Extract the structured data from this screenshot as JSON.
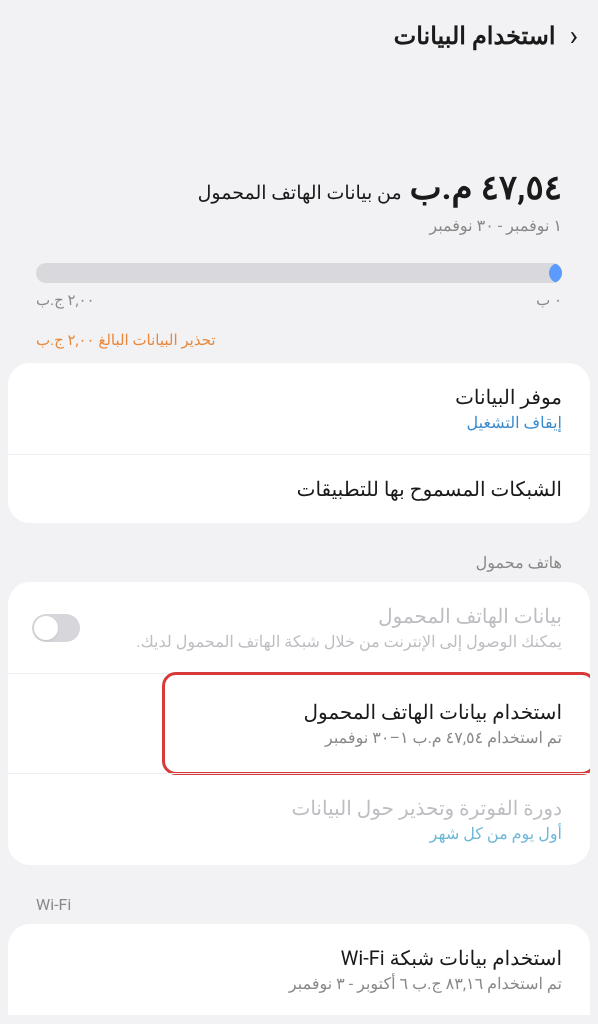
{
  "header": {
    "title": "استخدام البيانات"
  },
  "summary": {
    "amount": "٤٧,٥٤",
    "unit": "م.ب",
    "suffix": "من بيانات الهاتف المحمول",
    "date_range": "١ نوفمبر - ٣٠ نوفمبر"
  },
  "progress": {
    "min_label": "٠ ب",
    "max_label": "٢,٠٠ ج.ب",
    "fill_percent": 2.4
  },
  "warning_text": "تحذير البيانات البالغ ٢,٠٠ ج.ب",
  "card1": {
    "data_saver": {
      "title": "موفر البيانات",
      "sub": "إيقاف التشغيل"
    },
    "allowed_networks": {
      "title": "الشبكات المسموح بها للتطبيقات"
    }
  },
  "sections": {
    "mobile": "هاتف محمول",
    "wifi": "Wi-Fi"
  },
  "mobile_card": {
    "mobile_data": {
      "title": "بيانات الهاتف المحمول",
      "sub": "يمكنك الوصول إلى الإنترنت من خلال شبكة الهاتف المحمول لديك."
    },
    "mobile_usage": {
      "title": "استخدام بيانات الهاتف المحمول",
      "sub": "تم استخدام ٤٧,٥٤ م.ب ١–٣٠ نوفمبر"
    },
    "billing": {
      "title": "دورة الفوترة وتحذير حول البيانات",
      "sub": "أول يوم من كل شهر"
    }
  },
  "wifi_card": {
    "wifi_usage": {
      "title": "استخدام بيانات شبكة Wi-Fi",
      "sub": "تم استخدام ٨٣,١٦ ج.ب ٦ أكتوبر - ٣ نوفمبر"
    }
  }
}
